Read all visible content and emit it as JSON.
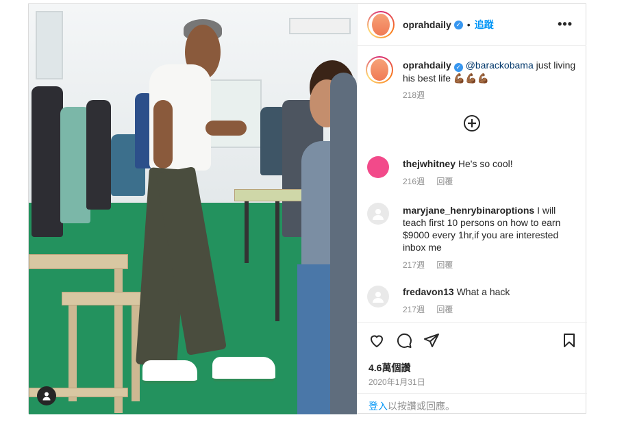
{
  "header": {
    "username": "oprahdaily",
    "dot": "•",
    "follow_label": "追蹤",
    "more_label": "•••"
  },
  "caption": {
    "username": "oprahdaily",
    "mention": "@barackobama",
    "text": " just living his best life 💪🏾💪🏾💪🏾",
    "time": "218週"
  },
  "load_more_label": "+",
  "comments": [
    {
      "username": "thejwhitney",
      "text": "He's so cool!",
      "time": "216週",
      "reply_label": "回覆"
    },
    {
      "username": "maryjane_henrybinaroptions",
      "text": "I will teach first 10 persons on how to earn $9000 every 1hr,if you are interested inbox me",
      "time": "217週",
      "reply_label": "回覆"
    },
    {
      "username": "fredavon13",
      "text": "What a hack",
      "time": "217週",
      "reply_label": "回覆"
    }
  ],
  "actions": {
    "likes": "4.6萬個讚",
    "date": "2020年1月31日"
  },
  "footer": {
    "login_link": "登入",
    "login_text": "以按讚或回應。"
  },
  "colors": {
    "accent": "#0095f6",
    "verified": "#3897f0",
    "muted": "#8e8e8e",
    "border": "#dbdbdb"
  },
  "icons": [
    "verified-badge-icon",
    "more-options-icon",
    "add-circle-icon",
    "heart-icon",
    "comment-icon",
    "share-icon",
    "bookmark-icon",
    "user-tag-icon"
  ]
}
